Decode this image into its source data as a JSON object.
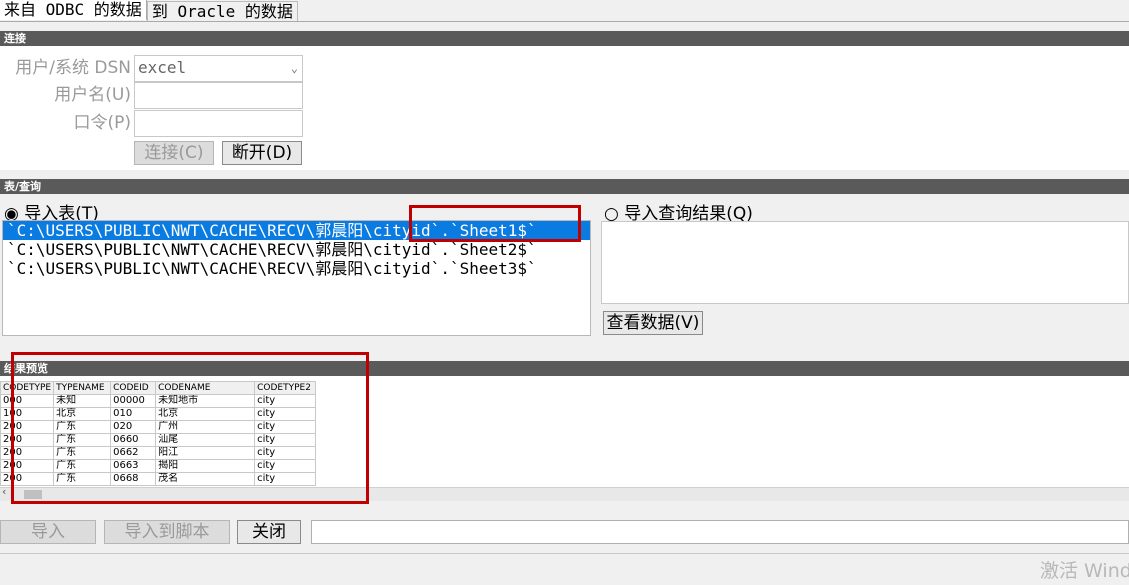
{
  "tabs": [
    "来自 ODBC 的数据",
    "到 Oracle 的数据"
  ],
  "connection": {
    "section_title": "连接",
    "dsn_label": "用户/系统 DSN",
    "dsn_value": "excel",
    "user_label": "用户名(U)",
    "user_value": "",
    "password_label": "口令(P)",
    "password_value": "",
    "connect_button": "连接(C)",
    "disconnect_button": "断开(D)"
  },
  "table_query": {
    "section_title": "表/查询",
    "import_table_radio": "◉ 导入表(T)",
    "import_query_radio": "○ 导入查询结果(Q)",
    "tables": [
      "`C:\\USERS\\PUBLIC\\NWT\\CACHE\\RECV\\郭晨阳\\cityid`.`Sheet1$`",
      "`C:\\USERS\\PUBLIC\\NWT\\CACHE\\RECV\\郭晨阳\\cityid`.`Sheet2$`",
      "`C:\\USERS\\PUBLIC\\NWT\\CACHE\\RECV\\郭晨阳\\cityid`.`Sheet3$`"
    ],
    "view_data_button": "查看数据(V)"
  },
  "preview": {
    "section_title": "结果预览",
    "columns": [
      "CODETYPE",
      "TYPENAME",
      "CODEID",
      "CODENAME",
      "CODETYPE2"
    ],
    "rows": [
      [
        "000",
        "未知",
        "00000",
        "未知地市",
        "city"
      ],
      [
        "100",
        "北京",
        "010",
        "北京",
        "city"
      ],
      [
        "200",
        "广东",
        "020",
        "广州",
        "city"
      ],
      [
        "200",
        "广东",
        "0660",
        "汕尾",
        "city"
      ],
      [
        "200",
        "广东",
        "0662",
        "阳江",
        "city"
      ],
      [
        "200",
        "广东",
        "0663",
        "揭阳",
        "city"
      ],
      [
        "200",
        "广东",
        "0668",
        "茂名",
        "city"
      ]
    ]
  },
  "actions": {
    "import_button": "导入",
    "import_to_script_button": "导入到脚本",
    "close_button": "关闭"
  },
  "watermark": "激活 Wind"
}
